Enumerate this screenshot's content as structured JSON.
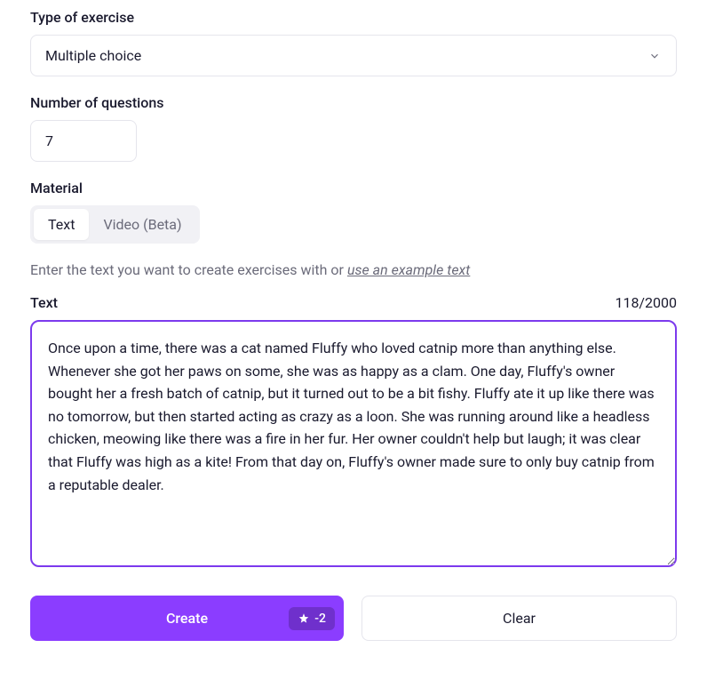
{
  "type_of_exercise": {
    "label": "Type of exercise",
    "selected": "Multiple choice"
  },
  "number_of_questions": {
    "label": "Number of questions",
    "value": "7"
  },
  "material": {
    "label": "Material",
    "tabs": [
      {
        "label": "Text",
        "active": true
      },
      {
        "label": "Video (Beta)",
        "active": false
      }
    ]
  },
  "helper": {
    "prefix": "Enter the text you want to create exercises with or ",
    "link": "use an example text"
  },
  "text_section": {
    "label": "Text",
    "counter": "118/2000",
    "content": "Once upon a time, there was a cat named Fluffy who loved catnip more than anything else. Whenever she got her paws on some, she was as happy as a clam. One day, Fluffy's owner bought her a fresh batch of catnip, but it turned out to be a bit fishy. Fluffy ate it up like there was no tomorrow, but then started acting as crazy as a loon. She was running around like a headless chicken, meowing like there was a fire in her fur. Her owner couldn't help but laugh; it was clear that Fluffy was high as a kite! From that day on, Fluffy's owner made sure to only buy catnip from a reputable dealer."
  },
  "buttons": {
    "create": "Create",
    "create_cost": "-2",
    "clear": "Clear"
  }
}
